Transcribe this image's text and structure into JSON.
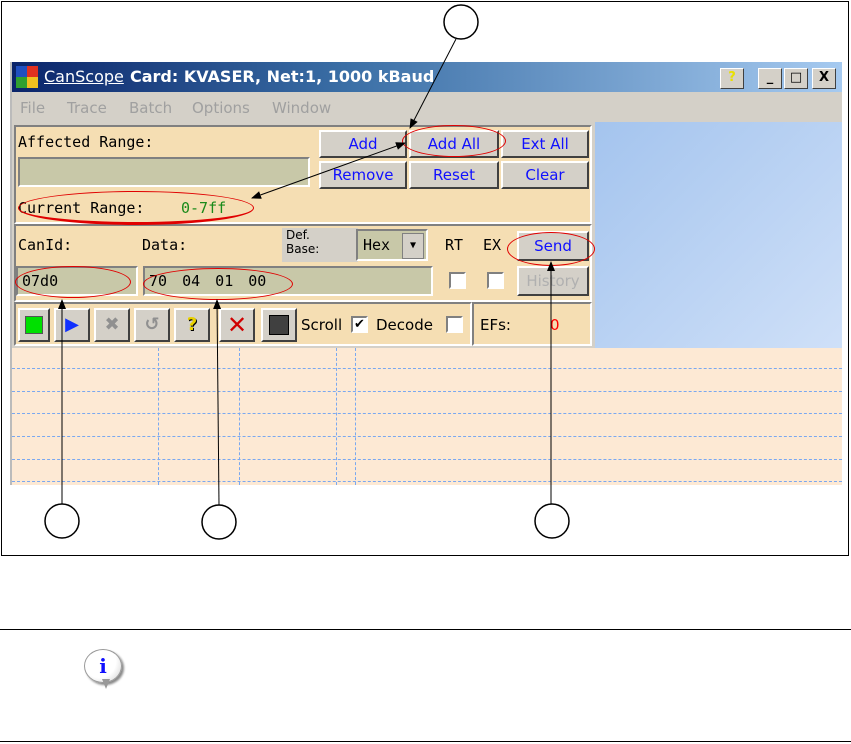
{
  "window": {
    "app_name": "CanScope",
    "title": "Card: KVASER, Net:1, 1000 kBaud",
    "controls": {
      "help": "?",
      "minimize": "_",
      "maximize": "□",
      "close": "X"
    }
  },
  "menu": [
    "File",
    "Trace",
    "Batch",
    "Options",
    "Window"
  ],
  "range_panel": {
    "affected_label": "Affected Range:",
    "affected_value": "",
    "current_label": "Current Range:",
    "current_value": "0-7ff",
    "buttons": {
      "add": "Add",
      "add_all": "Add All",
      "ext_all": "Ext All",
      "remove": "Remove",
      "reset": "Reset",
      "clear": "Clear"
    }
  },
  "send_panel": {
    "canid_label": "CanId:",
    "data_label": "Data:",
    "def_base_label_1": "Def.",
    "def_base_label_2": "Base:",
    "base_value": "Hex",
    "rt_label": "RT",
    "ex_label": "EX",
    "canid_value": "07d0",
    "data_value": "70 04 01 00",
    "send_button": "Send",
    "history_button": "History",
    "rt_checked": false,
    "ex_checked": false
  },
  "toolbar": {
    "scroll_label": "Scroll",
    "scroll_checked": true,
    "decode_label": "Decode",
    "decode_checked": false,
    "efs_label": "EFs:",
    "efs_value": "0",
    "help_glyph": "?"
  },
  "colors": {
    "panel": "#f5deb3",
    "field": "#c8c8a8",
    "button_text": "#1010ff",
    "current_range": "#1a8a1a",
    "efs_value": "#ff0000",
    "callout": "#e00000"
  },
  "note": {
    "icon": "info-icon",
    "glyph": "i"
  }
}
